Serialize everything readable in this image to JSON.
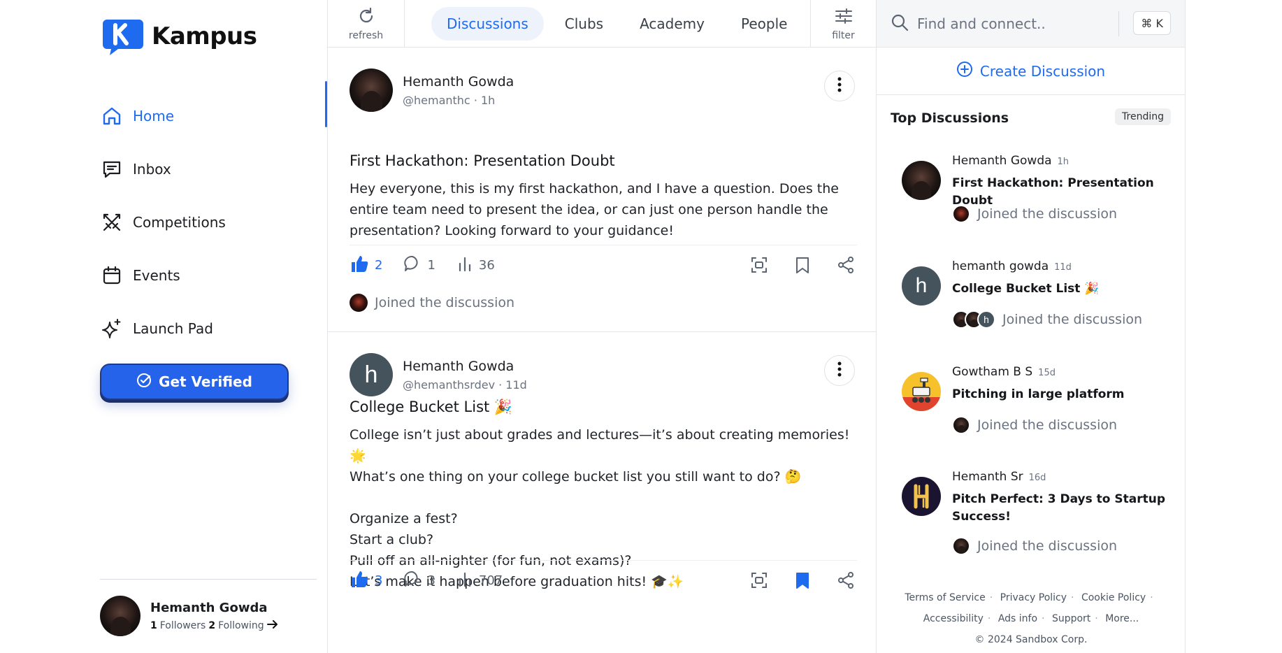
{
  "app": {
    "name": "Kampus",
    "accent": "#1f6bf0"
  },
  "sidebar": {
    "items": [
      {
        "label": "Home",
        "icon": "home-icon",
        "active": true
      },
      {
        "label": "Inbox",
        "icon": "inbox-icon"
      },
      {
        "label": "Competitions",
        "icon": "swords-icon"
      },
      {
        "label": "Events",
        "icon": "calendar-icon"
      },
      {
        "label": "Launch Pad",
        "icon": "sparkles-icon"
      }
    ],
    "verify_label": "Get Verified",
    "profile": {
      "name": "Hemanth Gowda",
      "followers_count": "1",
      "followers_label": "Followers",
      "following_count": "2",
      "following_label": "Following"
    }
  },
  "topbar": {
    "refresh_label": "refresh",
    "filter_label": "filter",
    "tabs": [
      "Discussions",
      "Clubs",
      "Academy",
      "People"
    ],
    "active_tab": "Discussions"
  },
  "posts": [
    {
      "author": "Hemanth Gowda",
      "handle": "@hemanthc",
      "time": "1h",
      "title": "First Hackathon: Presentation Doubt",
      "body": " Hey everyone, this is my first hackathon, and I have a question. Does the entire team need to present the idea, or can just one person handle the presentation? Looking forward to your guidance!",
      "likes": "2",
      "comments": "1",
      "views": "36",
      "joined_label": "Joined the discussion",
      "bookmarked": false
    },
    {
      "author": "Hemanth Gowda",
      "handle": "@hemanthsrdev",
      "time": "11d",
      "avatar_letter": "h",
      "title": "College Bucket List 🎉",
      "body": "College isn’t just about grades and lectures—it’s about creating memories! 🌟\nWhat’s one thing on your college bucket list you still want to do? 🤔\n\nOrganize a fest?\nStart a club?\nPull off an all-nighter (for fun, not exams)?\nLet’s make it happen before graduation hits! 🎓✨",
      "likes": "3",
      "comments": "3",
      "views": "707",
      "bookmarked": true
    }
  ],
  "right": {
    "search_placeholder": "Find and connect..",
    "shortcut": "⌘ K",
    "create_label": "Create Discussion",
    "top_title": "Top Discussions",
    "trending_label": "Trending",
    "top_discussions": [
      {
        "author": "Hemanth Gowda",
        "ago": "1h",
        "title": "First Hackathon: Presentation Doubt",
        "joined": "Joined the discussion"
      },
      {
        "author": "hemanth gowda",
        "ago": "11d",
        "title": "College Bucket List 🎉",
        "joined": "Joined the discussion",
        "avatar_letter": "h"
      },
      {
        "author": "Gowtham B S",
        "ago": "15d",
        "title": "Pitching in large platform",
        "joined": "Joined the discussion"
      },
      {
        "author": "Hemanth Sr",
        "ago": "16d",
        "title": "Pitch Perfect: 3 Days to Startup Success!",
        "joined": "Joined the discussion"
      }
    ],
    "footer": {
      "links": [
        "Terms of Service",
        "Privacy Policy",
        "Cookie Policy",
        "Accessibility",
        "Ads info",
        "Support",
        "More..."
      ],
      "copyright": "© 2024 Sandbox Corp."
    }
  }
}
